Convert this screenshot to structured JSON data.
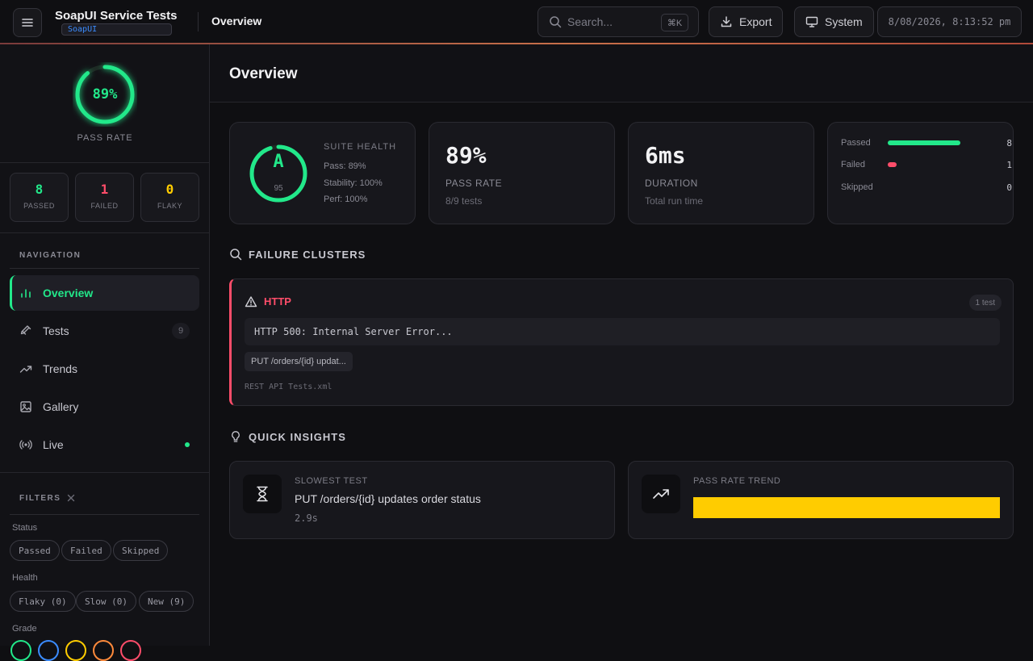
{
  "header": {
    "app_title": "SoapUI Service Tests",
    "app_badge": "SoapUI",
    "page": "Overview",
    "search_placeholder": "Search...",
    "search_shortcut": "⌘K",
    "export_label": "Export",
    "system_label": "System",
    "datetime": "8/08/2026, 8:13:52 pm"
  },
  "sidebar": {
    "pass_rate": "89%",
    "pass_rate_value": 0.89,
    "pass_rate_caption": "PASS RATE",
    "stats": [
      {
        "num": "8",
        "label": "PASSED",
        "color": "#22e88a"
      },
      {
        "num": "1",
        "label": "FAILED",
        "color": "#ff4d6a"
      },
      {
        "num": "0",
        "label": "FLAKY",
        "color": "#ffcc00"
      }
    ],
    "nav_title": "NAVIGATION",
    "nav": [
      {
        "label": "Overview",
        "icon": "bar-chart-icon"
      },
      {
        "label": "Tests",
        "icon": "flask-icon",
        "count": "9"
      },
      {
        "label": "Trends",
        "icon": "trending-up-icon"
      },
      {
        "label": "Gallery",
        "icon": "image-icon"
      },
      {
        "label": "Live",
        "icon": "radio-icon"
      }
    ],
    "filters_title": "FILTERS",
    "status_label": "Status",
    "status_chips": [
      "Passed",
      "Failed",
      "Skipped"
    ],
    "health_label": "Health",
    "health_chips": [
      "Flaky (0)",
      "Slow (0)",
      "New (9)"
    ],
    "grade_label": "Grade",
    "grade_colors": [
      "#22e88a",
      "#3b8cff",
      "#ffcc00",
      "#ff8a3b",
      "#ff4d6a"
    ]
  },
  "main": {
    "title": "Overview",
    "health": {
      "title": "SUITE HEALTH",
      "grade": "A",
      "score": "95",
      "score_value": 0.95,
      "lines": [
        "Pass: 89%",
        "Stability: 100%",
        "Perf: 100%"
      ]
    },
    "pass_card": {
      "value": "89%",
      "label": "PASS RATE",
      "sub": "8/9 tests"
    },
    "duration_card": {
      "value": "6ms",
      "label": "DURATION",
      "sub": "Total run time"
    },
    "breakdown": [
      {
        "name": "Passed",
        "count": "8",
        "fraction": 1.0,
        "color": "#22e88a"
      },
      {
        "name": "Failed",
        "count": "1",
        "fraction": 0.125,
        "color": "#ff4d6a"
      },
      {
        "name": "Skipped",
        "count": "0",
        "fraction": 0,
        "color": "#7c7c86"
      }
    ],
    "failure_clusters_title": "FAILURE CLUSTERS",
    "cluster": {
      "title": "HTTP",
      "count": "1 test",
      "error": "HTTP 500: Internal Server Error...",
      "test": "PUT /orders/{id} updat...",
      "file": "REST API Tests.xml"
    },
    "insights_title": "QUICK INSIGHTS",
    "slowest": {
      "label": "SLOWEST TEST",
      "value": "PUT /orders/{id} updates order status",
      "sub": "2.9s"
    },
    "trend": {
      "label": "PASS RATE TREND",
      "color": "#ffcc00"
    }
  }
}
